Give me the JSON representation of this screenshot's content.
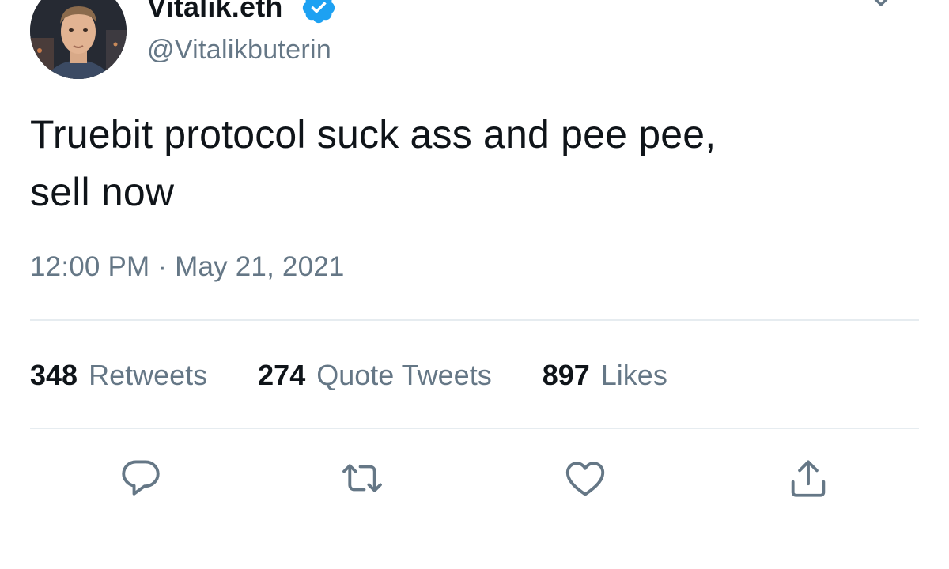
{
  "author": {
    "display_name": "Vitalik.eth",
    "handle": "@Vitalikbuterin",
    "verified": true
  },
  "tweet": {
    "text_line1": "Truebit protocol suck ass and pee pee,",
    "text_line2": "sell now",
    "timestamp": "12:00 PM · May 21, 2021"
  },
  "stats": {
    "retweets_count": "348",
    "retweets_label": "Retweets",
    "quotes_count": "274",
    "quotes_label": "Quote Tweets",
    "likes_count": "897",
    "likes_label": "Likes"
  },
  "actions": {
    "reply_icon": "comment-icon",
    "retweet_icon": "retweet-icon",
    "like_icon": "heart-icon",
    "share_icon": "share-icon"
  },
  "colors": {
    "text": "#0f1419",
    "secondary": "#657786",
    "verified": "#1da1f2",
    "divider": "#e6ecf0"
  }
}
